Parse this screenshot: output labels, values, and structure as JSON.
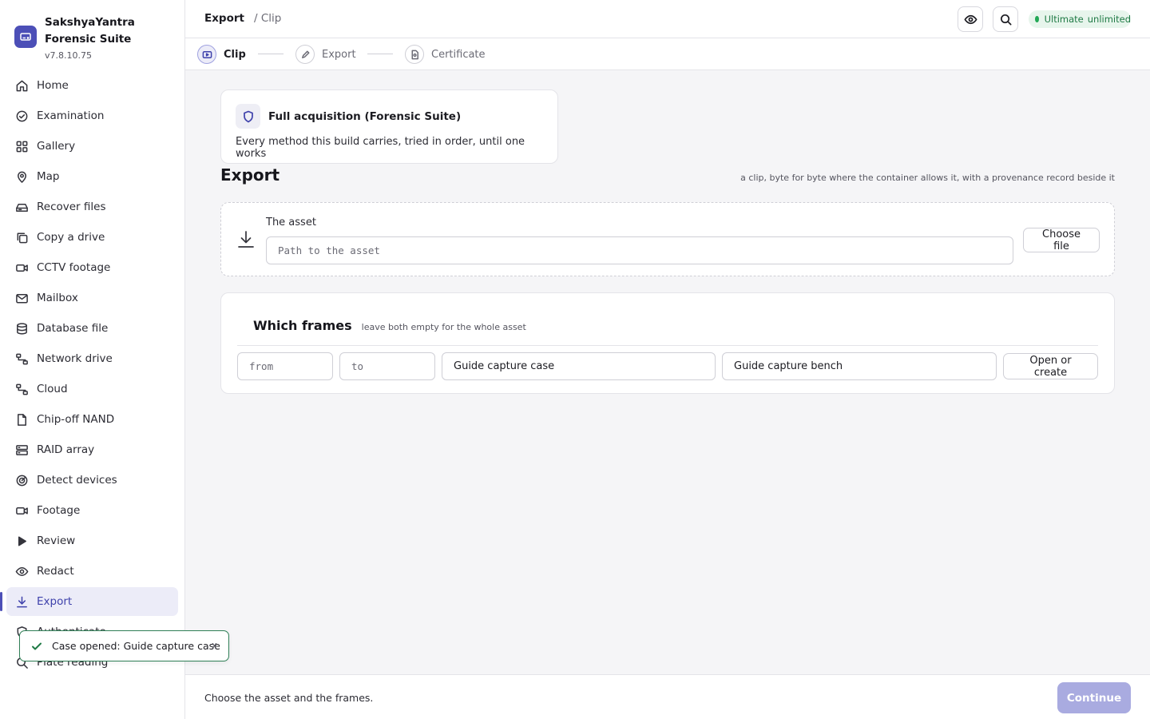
{
  "app": {
    "name": "SakshyaYantra Forensic Suite",
    "version": "v7.8.10.75"
  },
  "sidebar": {
    "items": [
      {
        "label": "Home",
        "icon": "home-icon"
      },
      {
        "label": "Examination",
        "icon": "check-circle-icon"
      },
      {
        "label": "Gallery",
        "icon": "grid-icon"
      },
      {
        "label": "Map",
        "icon": "map-pin-icon"
      },
      {
        "label": "Recover files",
        "icon": "hard-drive-icon"
      },
      {
        "label": "Copy a drive",
        "icon": "copy-icon"
      },
      {
        "label": "CCTV footage",
        "icon": "video-icon"
      },
      {
        "label": "Mailbox",
        "icon": "mail-icon"
      },
      {
        "label": "Database file",
        "icon": "database-icon"
      },
      {
        "label": "Network drive",
        "icon": "network-icon"
      },
      {
        "label": "Cloud",
        "icon": "cloud-network-icon"
      },
      {
        "label": "Chip-off NAND",
        "icon": "file-icon"
      },
      {
        "label": "RAID array",
        "icon": "server-icon"
      },
      {
        "label": "Detect devices",
        "icon": "radar-icon"
      },
      {
        "label": "Footage",
        "icon": "video-icon"
      },
      {
        "label": "Review",
        "icon": "play-icon"
      },
      {
        "label": "Redact",
        "icon": "eye-icon"
      },
      {
        "label": "Export",
        "icon": "download-icon",
        "active": true
      },
      {
        "label": "Authenticate",
        "icon": "shield-icon"
      },
      {
        "label": "Plate reading",
        "icon": "search-icon"
      }
    ]
  },
  "topbar": {
    "breadcrumb_main": "Export",
    "breadcrumb_sub": "/ Clip",
    "plan_badge_tier": "Ultimate",
    "plan_badge_limit": "unlimited"
  },
  "stepper": {
    "steps": [
      {
        "label": "Clip",
        "state": "current"
      },
      {
        "label": "Export",
        "state": "pending"
      },
      {
        "label": "Certificate",
        "state": "pending"
      }
    ]
  },
  "method": {
    "title": "Full acquisition (Forensic Suite)",
    "description": "Every method this build carries, tried in order, until one works"
  },
  "section": {
    "title": "Export",
    "note": "a clip, byte for byte where the container allows it, with a provenance record beside it"
  },
  "asset": {
    "label": "The asset",
    "placeholder": "Path to the asset",
    "value": "",
    "choose_label": "Choose file"
  },
  "frames": {
    "title": "Which frames",
    "hint": "leave both empty for the whole asset",
    "from_placeholder": "from",
    "to_placeholder": "to",
    "case_value": "Guide capture case",
    "bench_value": "Guide capture bench",
    "open_label": "Open or create"
  },
  "footer": {
    "status": "Choose the asset and the frames.",
    "continue_label": "Continue"
  },
  "toast": {
    "message": "Case opened: Guide capture case",
    "close": "x"
  },
  "colors": {
    "accent": "#4c4fb7",
    "accent_light": "#ececf8",
    "success": "#22a855",
    "continue_disabled": "#a9abe0"
  }
}
